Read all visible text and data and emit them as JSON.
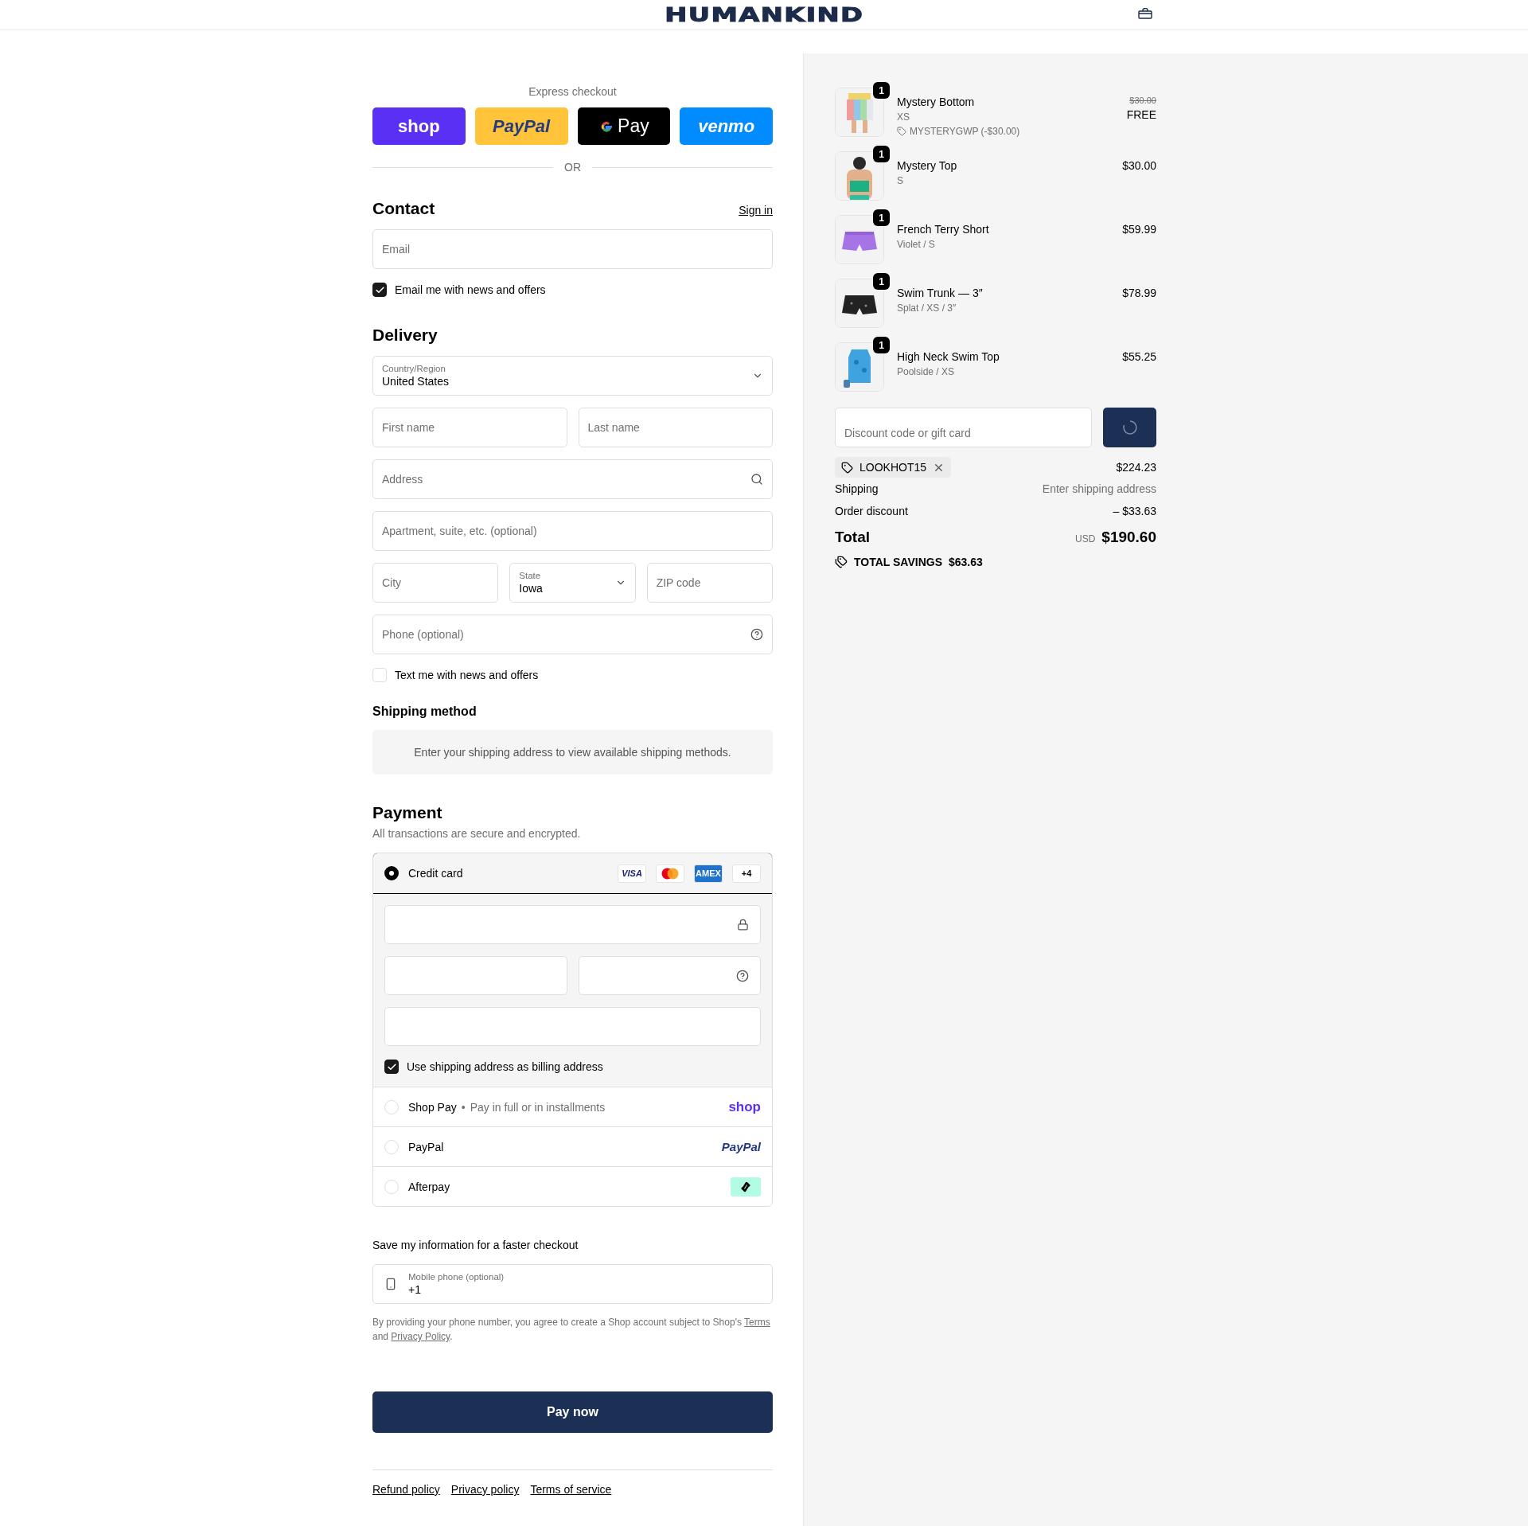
{
  "header": {
    "logo": "HUMANKIND"
  },
  "express": {
    "title": "Express checkout",
    "buttons": [
      {
        "kind": "shop",
        "label": "shop"
      },
      {
        "kind": "paypal",
        "label": "PayPal"
      },
      {
        "kind": "gpay",
        "label": "Pay"
      },
      {
        "kind": "venmo",
        "label": "venmo"
      }
    ],
    "divider": "OR"
  },
  "contact": {
    "title": "Contact",
    "link": "Sign in",
    "email": {
      "placeholder": "Email"
    },
    "newsletter": {
      "label": "Email me with news and offers",
      "checked": true
    }
  },
  "delivery": {
    "title": "Delivery",
    "rows": [
      [
        {
          "kind": "select",
          "label": "Country/Region",
          "value": "United States"
        }
      ],
      [
        {
          "kind": "text",
          "placeholder": "First name"
        },
        {
          "kind": "text",
          "placeholder": "Last name"
        }
      ],
      [
        {
          "kind": "text",
          "placeholder": "Address"
        }
      ],
      [
        {
          "kind": "text",
          "placeholder": "Apartment, suite, etc. (optional)"
        }
      ],
      [
        {
          "kind": "text",
          "placeholder": "City"
        },
        {
          "kind": "select",
          "label": "State",
          "value": "Iowa"
        },
        {
          "kind": "text",
          "placeholder": "ZIP code"
        }
      ],
      [
        {
          "kind": "text",
          "placeholder": "Phone (optional)"
        }
      ]
    ],
    "sms": {
      "label": "Text me with news and offers",
      "checked": false
    }
  },
  "shipping_method": {
    "title": "Shipping method",
    "message": "Enter your shipping address to view available shipping methods."
  },
  "payment": {
    "title": "Payment",
    "subtitle": "All transactions are secure and encrypted.",
    "methods": [
      {
        "kind": "card",
        "label": "Credit card",
        "selected": true,
        "brands": [
          {
            "kind": "visa",
            "label": "VISA"
          },
          {
            "kind": "mastercard"
          },
          {
            "kind": "amex",
            "label": "AMEX"
          },
          {
            "kind": "more",
            "label": "+4"
          }
        ],
        "billing": {
          "label": "Use shipping address as billing address",
          "checked": true
        }
      },
      {
        "kind": "shop_pay",
        "label": "Shop Pay",
        "separator": "•",
        "note": "Pay in full or in installments",
        "logo": "shop",
        "selected": false
      },
      {
        "kind": "paypal",
        "label": "PayPal",
        "logo": "PayPal",
        "selected": false
      },
      {
        "kind": "afterpay",
        "label": "Afterpay",
        "selected": false
      }
    ]
  },
  "remember": {
    "title": "Save my information for a faster checkout",
    "phone": {
      "label": "Mobile phone (optional)",
      "value": "+1"
    },
    "legal": [
      {
        "kind": "text",
        "text": "By providing your phone number, you agree to create a Shop account subject to Shop's "
      },
      {
        "kind": "link",
        "text": "Terms"
      },
      {
        "kind": "text",
        "text": " and "
      },
      {
        "kind": "link",
        "text": "Privacy Policy"
      },
      {
        "kind": "text",
        "text": "."
      }
    ]
  },
  "pay_button": "Pay now",
  "footer_links": [
    "Refund policy",
    "Privacy policy",
    "Terms of service"
  ],
  "summary": {
    "items": [
      {
        "name": "Mystery Bottom",
        "variant": "XS",
        "quantity": "1",
        "compare_price": "$30.00",
        "price": "FREE",
        "discount": "MYSTERYGWP (-$30.00)"
      },
      {
        "name": "Mystery Top",
        "variant": "S",
        "quantity": "1",
        "price": "$30.00"
      },
      {
        "name": "French Terry Short",
        "variant": "Violet / S",
        "quantity": "1",
        "price": "$59.99"
      },
      {
        "name": "Swim Trunk — 3″",
        "variant": "Splat / XS / 3″",
        "quantity": "1",
        "price": "$78.99"
      },
      {
        "name": "High Neck Swim Top",
        "variant": "Poolside / XS",
        "quantity": "1",
        "price": "$55.25"
      }
    ],
    "discount_field": {
      "placeholder": "Discount code or gift card"
    },
    "applied_code": "LOOKHOT15",
    "subtotal": "$224.23",
    "shipping": {
      "label": "Shipping",
      "value": "Enter shipping address"
    },
    "order_discount": {
      "label": "Order discount",
      "value": "– $33.63"
    },
    "total": {
      "label": "Total",
      "currency": "USD",
      "value": "$190.60"
    },
    "savings": {
      "label": "TOTAL SAVINGS",
      "value": "$63.63"
    }
  }
}
